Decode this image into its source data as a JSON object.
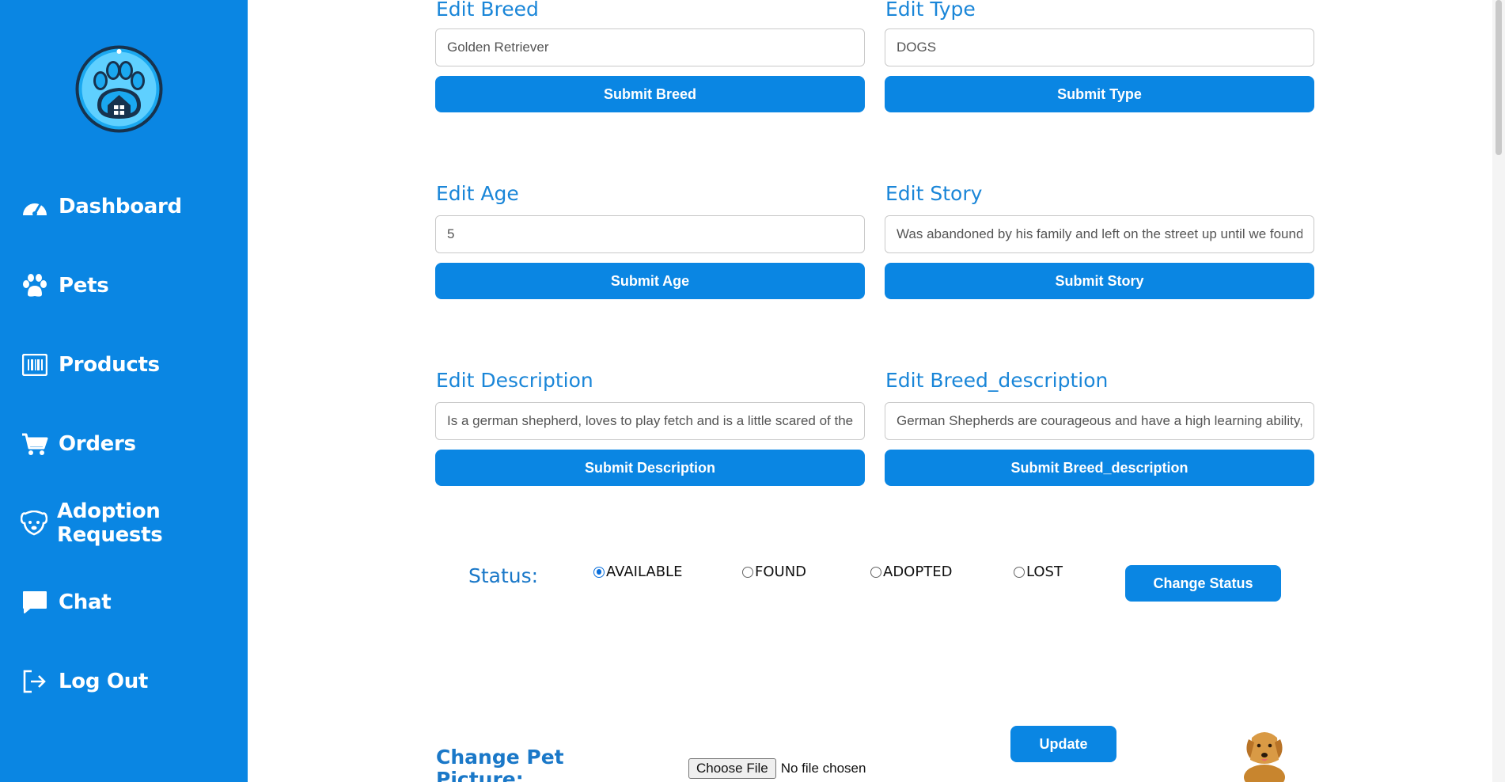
{
  "sidebar": {
    "items": [
      {
        "label": "Dashboard",
        "icon": "dashboard-gauge-icon"
      },
      {
        "label": "Pets",
        "icon": "paw-icon"
      },
      {
        "label": "Products",
        "icon": "barcode-icon"
      },
      {
        "label": "Orders",
        "icon": "cart-icon"
      },
      {
        "label": "Adoption Requests",
        "icon": "dog-face-icon"
      },
      {
        "label": "Chat",
        "icon": "chat-bubble-icon"
      },
      {
        "label": "Log Out",
        "icon": "logout-icon"
      }
    ]
  },
  "form": {
    "breed": {
      "label": "Edit Breed",
      "value": "Golden Retriever",
      "button": "Submit Breed"
    },
    "type": {
      "label": "Edit Type",
      "value": "DOGS",
      "button": "Submit Type"
    },
    "age": {
      "label": "Edit Age",
      "value": "5",
      "button": "Submit Age"
    },
    "story": {
      "label": "Edit Story",
      "value": "Was abandoned by his family and left on the street up until we found h",
      "button": "Submit Story"
    },
    "description": {
      "label": "Edit Description",
      "value": "Is a german shepherd, loves to play fetch and is a little scared of the w",
      "button": "Submit Description"
    },
    "breed_description": {
      "label": "Edit Breed_description",
      "value": "German Shepherds are courageous and have a high learning ability, o",
      "button": "Submit Breed_description"
    }
  },
  "status": {
    "label": "Status:",
    "options": [
      "AVAILABLE",
      "FOUND",
      "ADOPTED",
      "LOST"
    ],
    "selected": "AVAILABLE",
    "button": "Change Status"
  },
  "picture": {
    "label": "Change Pet Picture:",
    "file_button": "Choose File",
    "file_status": "No file chosen",
    "update_button": "Update"
  },
  "colors": {
    "sidebar": "#0a86e3",
    "accent": "#0a86e3",
    "label": "#1a86d8"
  }
}
